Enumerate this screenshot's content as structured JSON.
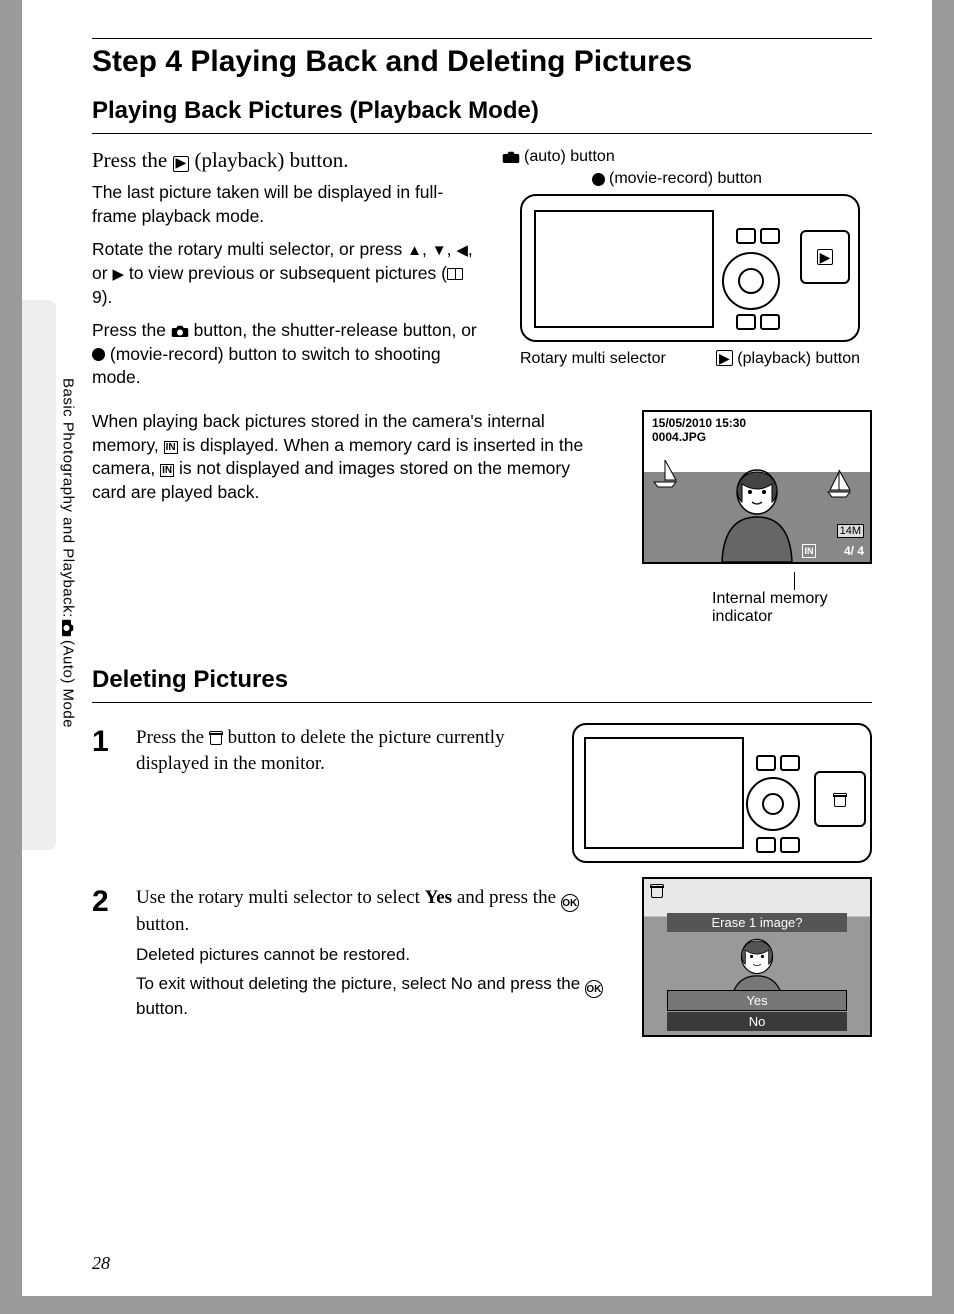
{
  "sideLabel": {
    "before": "Basic Photography and Playback: ",
    "after": " (Auto) Mode"
  },
  "heading": "Step 4 Playing Back and Deleting Pictures",
  "section1": {
    "title": "Playing Back Pictures (Playback Mode)",
    "instruction_before": "Press the ",
    "instruction_after": " (playback) button.",
    "p1": "The last picture taken will be displayed in full-frame playback mode.",
    "p2a": "Rotate the rotary multi selector, or press ",
    "p2b": ", or ",
    "p2c": " to view previous or subsequent pictures (",
    "p2d": " 9).",
    "p3a": "Press the ",
    "p3b": " button, the shutter-release button, or ",
    "p3c": " (movie-record) button to switch to shooting mode.",
    "p4a": "When playing back pictures stored in the camera's internal memory, ",
    "p4b": " is displayed. When a memory card is inserted in the camera, ",
    "p4c": " is not displayed and images stored on the memory card are played back."
  },
  "diagram": {
    "auto": "(auto) button",
    "movie": "(movie-record) button",
    "rotary": "Rotary multi selector",
    "playback": "(playback) button",
    "memInd": "Internal memory indicator"
  },
  "screenshot": {
    "timestamp": "15/05/2010 15:30",
    "filename": "0004.JPG",
    "mode": "14M",
    "count": "4/     4",
    "in": "IN"
  },
  "section2": {
    "title": "Deleting Pictures",
    "step1a": "Press the ",
    "step1b": " button to delete the picture currently displayed in the monitor.",
    "step2a": "Use the rotary multi selector to select ",
    "step2yes": "Yes",
    "step2b": " and press the ",
    "step2c": " button.",
    "note1": "Deleted pictures cannot be restored.",
    "note2a": "To exit without deleting the picture, select ",
    "note2no": "No",
    "note2b": " and press the ",
    "note2c": " button."
  },
  "dialog": {
    "question": "Erase 1 image?",
    "yes": "Yes",
    "no": "No"
  },
  "pageNumber": "28"
}
